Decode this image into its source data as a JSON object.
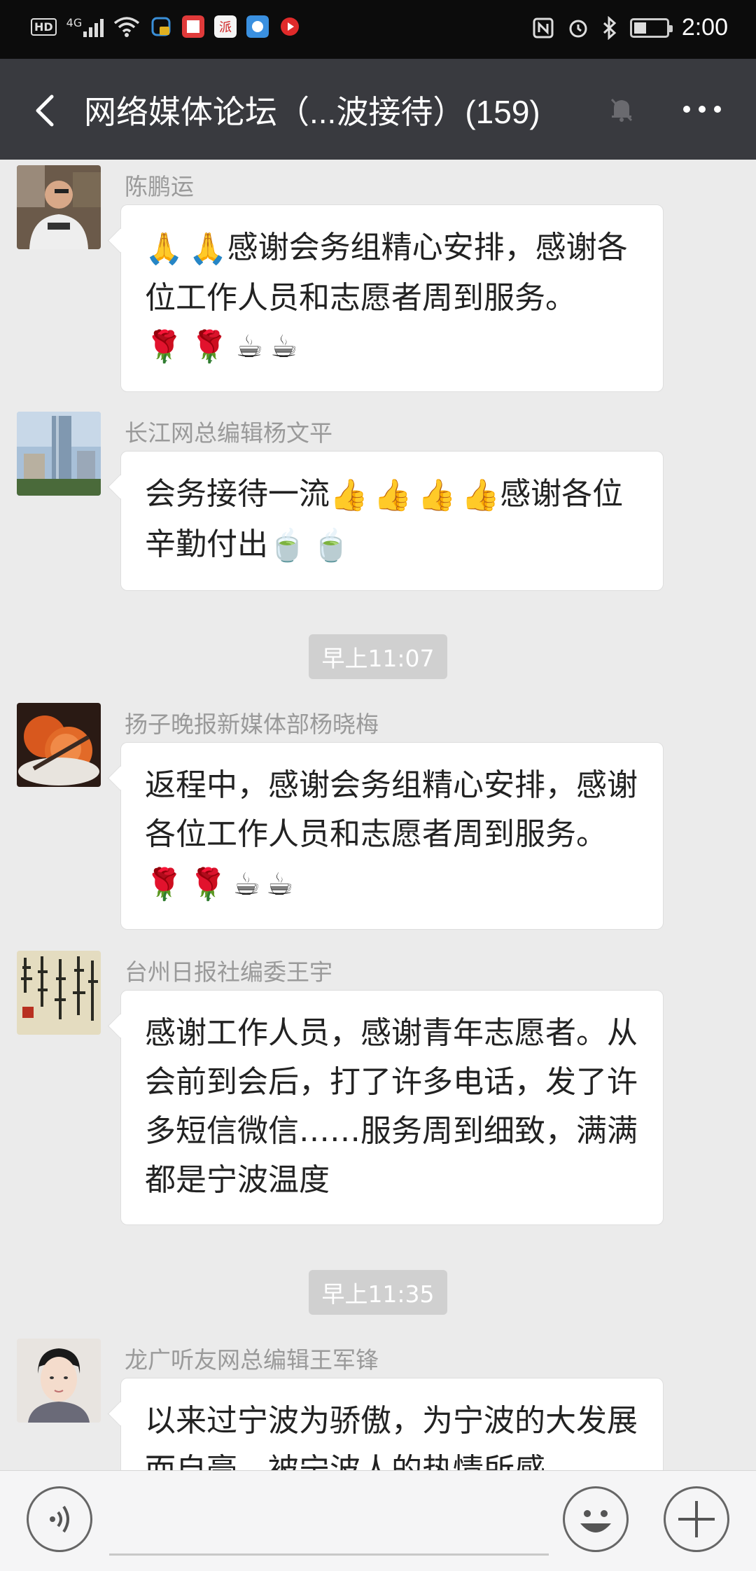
{
  "status_bar": {
    "network": "4G",
    "hd_label": "HD",
    "time": "2:00",
    "icons": [
      "hd-icon",
      "signal-icon",
      "wifi-icon",
      "app-notification-icon",
      "book-app-icon",
      "pai-app-icon",
      "photo-app-icon",
      "video-app-icon",
      "nfc-icon",
      "alarm-icon",
      "bluetooth-icon",
      "battery-icon"
    ]
  },
  "header": {
    "title": "网络媒体论坛（...波接待）(159)",
    "back_icon": "chevron-left-icon",
    "mute_icon": "bell-muted-icon",
    "more_icon": "more-dots-icon"
  },
  "messages": [
    {
      "sender": "陈鹏运",
      "text": "感谢会务组精心安排，感谢各位工作人员和志愿者周到服务。",
      "prefix_emojis": [
        "🙏",
        "🙏"
      ],
      "suffix_emojis": [
        "🌹",
        "🌹",
        "☕",
        "☕"
      ]
    },
    {
      "sender": "长江网总编辑杨文平",
      "text_a": "会务接待一流",
      "mid_emojis": [
        "👍",
        "👍",
        "👍",
        "👍"
      ],
      "text_b": "感谢各位辛勤付出",
      "suffix_emojis": [
        "🍵",
        "🍵"
      ]
    },
    {
      "sender": "扬子晚报新媒体部杨晓梅",
      "text": "返程中，感谢会务组精心安排，感谢各位工作人员和志愿者周到服务。",
      "suffix_emojis": [
        "🌹",
        "🌹",
        "☕",
        "☕"
      ]
    },
    {
      "sender": "台州日报社编委王宇",
      "text": "感谢工作人员，感谢青年志愿者。从会前到会后，打了许多电话，发了许多短信微信……服务周到细致，满满都是宁波温度"
    },
    {
      "sender": "龙广听友网总编辑王军锋",
      "text": "以来过宁波为骄傲，为宁波的大发展而自豪，被宁波人的热情所感"
    }
  ],
  "timestamps": [
    "早上11:07",
    "早上11:35"
  ],
  "input_bar": {
    "voice_icon": "voice-icon",
    "emoji_icon": "emoji-icon",
    "plus_icon": "plus-icon"
  },
  "colors": {
    "nav_bg": "#393a3f",
    "chat_bg": "#ebebeb",
    "status_bg": "#0c0c0c",
    "bubble_bg": "#ffffff",
    "timestamp_bg": "#d0d0d0"
  }
}
